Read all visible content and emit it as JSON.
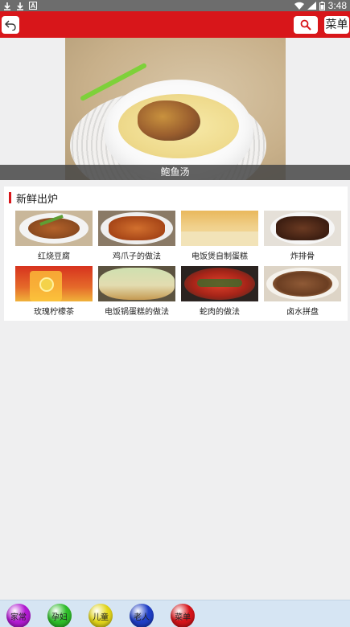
{
  "status_bar": {
    "time": "3:48",
    "left_icons": [
      "download-icon",
      "download-icon",
      "a-icon"
    ],
    "right_icons": [
      "wifi-icon",
      "signal-icon",
      "battery-icon"
    ]
  },
  "app_bar": {
    "menu_label": "菜单",
    "background_color": "#d8161a"
  },
  "hero": {
    "caption": "鲍鱼汤"
  },
  "section": {
    "title": "新鲜出炉",
    "accent_color": "#d8161a",
    "items": [
      {
        "label": "红烧豆腐"
      },
      {
        "label": "鸡爪子的做法"
      },
      {
        "label": "电饭煲自制蛋糕"
      },
      {
        "label": "炸排骨"
      },
      {
        "label": "玫瑰柠檬茶"
      },
      {
        "label": "电饭锅蛋糕的做法"
      },
      {
        "label": "蛇肉的做法"
      },
      {
        "label": "卤水拼盘"
      }
    ]
  },
  "bottom_nav": {
    "items": [
      {
        "label": "家常",
        "color": "#b41bd4"
      },
      {
        "label": "孕妇",
        "color": "#2fbf2a"
      },
      {
        "label": "儿童",
        "color": "#e4d71a"
      },
      {
        "label": "老人",
        "color": "#1f3fc8"
      },
      {
        "label": "菜单",
        "color": "#d7141a"
      }
    ]
  }
}
